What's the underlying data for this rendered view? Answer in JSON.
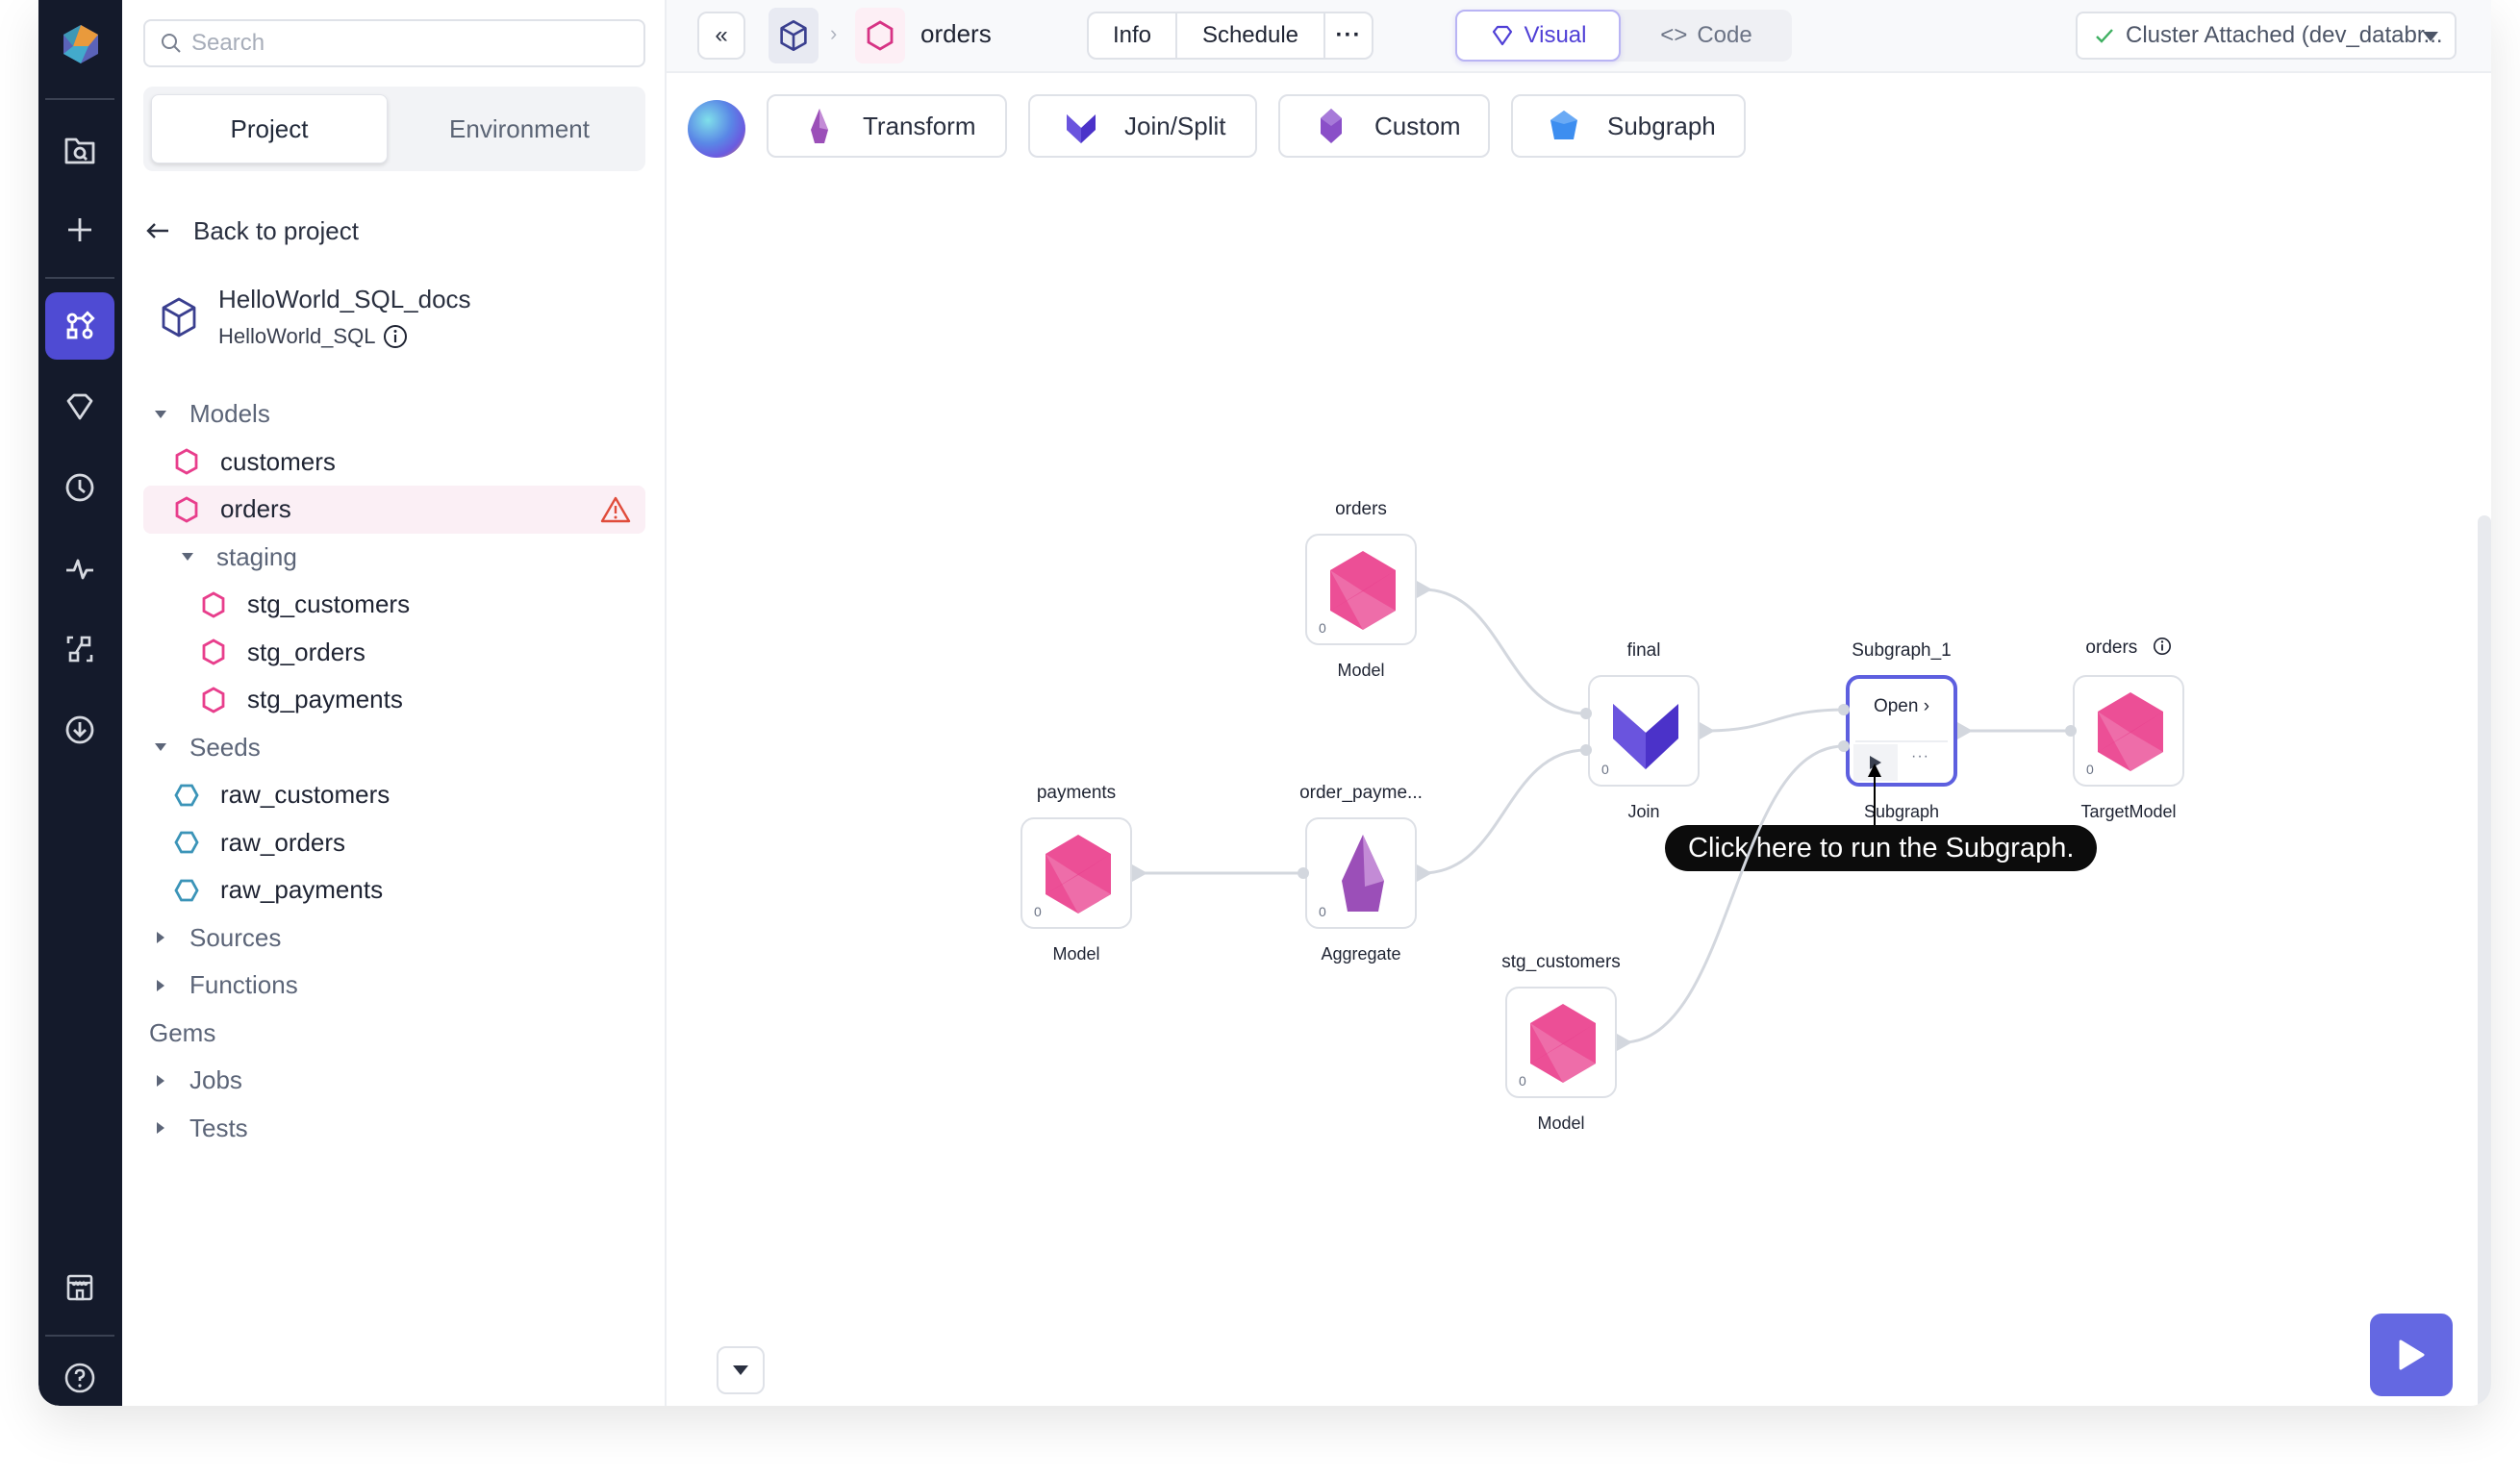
{
  "colors": {
    "rail_bg": "#141a2b",
    "accent": "#4f4bd3",
    "model_pink": "#e83e8c",
    "seed_teal": "#3b94b8",
    "warning_red": "#e04c3b",
    "subgraph_border": "#5d5fdf",
    "run_button": "#6468e2"
  },
  "rail": {
    "items": [
      {
        "name": "prophecy-logo",
        "icon": "logo-icon"
      },
      {
        "name": "browse-projects",
        "icon": "folder-search-icon"
      },
      {
        "name": "create-new",
        "icon": "plus-icon"
      },
      {
        "name": "pipelines",
        "icon": "pipeline-icon",
        "active": true
      },
      {
        "name": "gems",
        "icon": "gem-icon"
      },
      {
        "name": "schedules",
        "icon": "clock-icon"
      },
      {
        "name": "observability",
        "icon": "pulse-icon"
      },
      {
        "name": "lineage",
        "icon": "lineage-icon"
      },
      {
        "name": "deployments",
        "icon": "download-circle-icon"
      },
      {
        "name": "marketplace",
        "icon": "store-icon"
      },
      {
        "name": "help",
        "icon": "help-icon"
      }
    ]
  },
  "sidebar": {
    "search_placeholder": "Search",
    "tabs": [
      {
        "label": "Project",
        "active": true
      },
      {
        "label": "Environment",
        "active": false
      }
    ],
    "back_label": "Back to project",
    "project": {
      "name": "HelloWorld_SQL_docs",
      "subtitle": "HelloWorld_SQL"
    },
    "tree": [
      {
        "label": "Models",
        "type": "group",
        "expanded": true,
        "level": 0
      },
      {
        "label": "customers",
        "type": "model",
        "level": 1
      },
      {
        "label": "orders",
        "type": "model",
        "level": 1,
        "selected": true,
        "warning": true
      },
      {
        "label": "staging",
        "type": "group",
        "expanded": true,
        "level": 1
      },
      {
        "label": "stg_customers",
        "type": "model",
        "level": 2
      },
      {
        "label": "stg_orders",
        "type": "model",
        "level": 2
      },
      {
        "label": "stg_payments",
        "type": "model",
        "level": 2
      },
      {
        "label": "Seeds",
        "type": "group",
        "expanded": true,
        "level": 0
      },
      {
        "label": "raw_customers",
        "type": "seed",
        "level": 1
      },
      {
        "label": "raw_orders",
        "type": "seed",
        "level": 1
      },
      {
        "label": "raw_payments",
        "type": "seed",
        "level": 1
      },
      {
        "label": "Sources",
        "type": "group",
        "expanded": false,
        "level": 0
      },
      {
        "label": "Functions",
        "type": "group",
        "expanded": false,
        "level": 0
      },
      {
        "label": "Gems",
        "type": "plain",
        "level": 0
      },
      {
        "label": "Jobs",
        "type": "group",
        "expanded": false,
        "level": 0
      },
      {
        "label": "Tests",
        "type": "group",
        "expanded": false,
        "level": 0
      }
    ]
  },
  "topbar": {
    "collapse_label": "«",
    "breadcrumb_separator": "›",
    "title": "orders",
    "info_label": "Info",
    "schedule_label": "Schedule",
    "more_label": "···",
    "visual_label": "Visual",
    "code_label": "Code",
    "cluster_label": "Cluster Attached (dev_databr..."
  },
  "gembar": {
    "buttons": [
      {
        "label": "Transform",
        "icon": "transform-gem-icon"
      },
      {
        "label": "Join/Split",
        "icon": "join-split-gem-icon"
      },
      {
        "label": "Custom",
        "icon": "custom-gem-icon"
      },
      {
        "label": "Subgraph",
        "icon": "subgraph-gem-icon"
      }
    ]
  },
  "graph": {
    "nodes": [
      {
        "id": "orders",
        "title": "orders",
        "type": "Model",
        "count": "0",
        "gem": "model"
      },
      {
        "id": "final",
        "title": "final",
        "type": "Join",
        "count": "0",
        "gem": "join"
      },
      {
        "id": "subgraph",
        "title": "Subgraph_1",
        "type": "Subgraph",
        "open_label": "Open ›",
        "more_label": "···"
      },
      {
        "id": "target",
        "title": "orders",
        "type": "TargetModel",
        "count": "0",
        "gem": "model",
        "info": true
      },
      {
        "id": "payments",
        "title": "payments",
        "type": "Model",
        "count": "0",
        "gem": "model"
      },
      {
        "id": "agg",
        "title": "order_payme...",
        "type": "Aggregate",
        "count": "0",
        "gem": "aggregate"
      },
      {
        "id": "stg",
        "title": "stg_customers",
        "type": "Model",
        "count": "0",
        "gem": "model"
      }
    ],
    "edges": [
      [
        "orders",
        "final"
      ],
      [
        "agg",
        "final"
      ],
      [
        "payments",
        "agg"
      ],
      [
        "final",
        "subgraph"
      ],
      [
        "stg",
        "subgraph"
      ],
      [
        "subgraph",
        "target"
      ]
    ],
    "tooltip": "Click here to run the Subgraph."
  }
}
